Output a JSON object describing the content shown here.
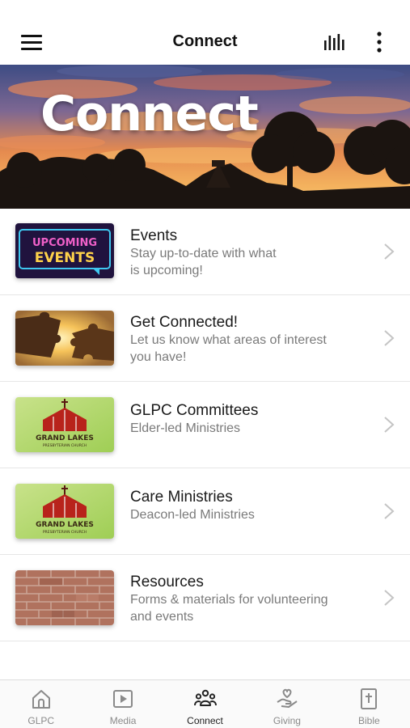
{
  "status_bar": {
    "time": ""
  },
  "header": {
    "title": "Connect",
    "menu_icon": "hamburger-menu-icon",
    "audio_icon": "audio-bars-icon",
    "more_icon": "more-vertical-icon"
  },
  "hero": {
    "title": "Connect"
  },
  "list": {
    "items": [
      {
        "title": "Events",
        "subtitle_line1": "Stay up-to-date with what",
        "subtitle_line2": "is upcoming!",
        "thumb_line1": "UPCOMING",
        "thumb_line2": "EVENTS"
      },
      {
        "title": "Get Connected!",
        "subtitle_line1": "Let us know what areas of interest",
        "subtitle_line2": "you have!"
      },
      {
        "title": "GLPC Committees",
        "subtitle_line1": "Elder-led Ministries",
        "thumb_line1": "GRAND LAKES",
        "thumb_line2": "PRESBYTERIAN CHURCH"
      },
      {
        "title": "Care Ministries",
        "subtitle_line1": "Deacon-led Ministries",
        "thumb_line1": "GRAND LAKES",
        "thumb_line2": "PRESBYTERIAN CHURCH"
      },
      {
        "title": "Resources",
        "subtitle_line1": "Forms & materials for volunteering",
        "subtitle_line2": "and events"
      }
    ]
  },
  "tabs": [
    {
      "label": "GLPC",
      "icon": "church-icon"
    },
    {
      "label": "Media",
      "icon": "play-icon"
    },
    {
      "label": "Connect",
      "icon": "people-group-icon",
      "active": true
    },
    {
      "label": "Giving",
      "icon": "hand-heart-icon"
    },
    {
      "label": "Bible",
      "icon": "bible-icon"
    }
  ],
  "colors": {
    "accent": "#222222",
    "inactive": "#8a8a8a",
    "divider": "#e6e6e6"
  }
}
